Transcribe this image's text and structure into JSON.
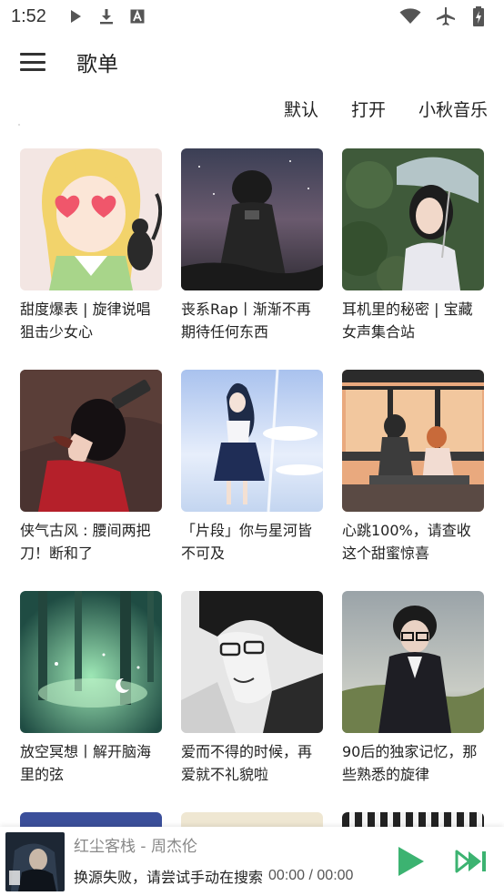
{
  "status_bar": {
    "time": "1:52",
    "left_icons": [
      "play-icon",
      "download-icon",
      "a-box-icon"
    ],
    "right_icons": [
      "wifi-icon",
      "airplane-icon",
      "battery-charging-icon"
    ]
  },
  "app_bar": {
    "title": "歌单",
    "menu_icon": "menu-icon"
  },
  "filters": [
    "默认",
    "打开",
    "小秋音乐"
  ],
  "playlists": [
    {
      "title": "甜度爆表 | 旋律说唱狙击少女心"
    },
    {
      "title": "丧系Rap丨渐渐不再期待任何东西"
    },
    {
      "title": "耳机里的秘密 | 宝藏女声集合站"
    },
    {
      "title": "侠气古风 : 腰间两把刀！断和了"
    },
    {
      "title": "「片段」你与星河皆不可及"
    },
    {
      "title": "心跳100%，请查收这个甜蜜惊喜"
    },
    {
      "title": "放空冥想丨解开脑海里的弦"
    },
    {
      "title": "爱而不得的时候，再爱就不礼貌啦"
    },
    {
      "title": "90后的独家记忆，那些熟悉的旋律"
    }
  ],
  "player": {
    "song": "红尘客栈 - 周杰伦",
    "message": "换源失败，请尝试手动在搜索",
    "time": "00:00 / 00:00",
    "accent_color": "#3cb371"
  }
}
